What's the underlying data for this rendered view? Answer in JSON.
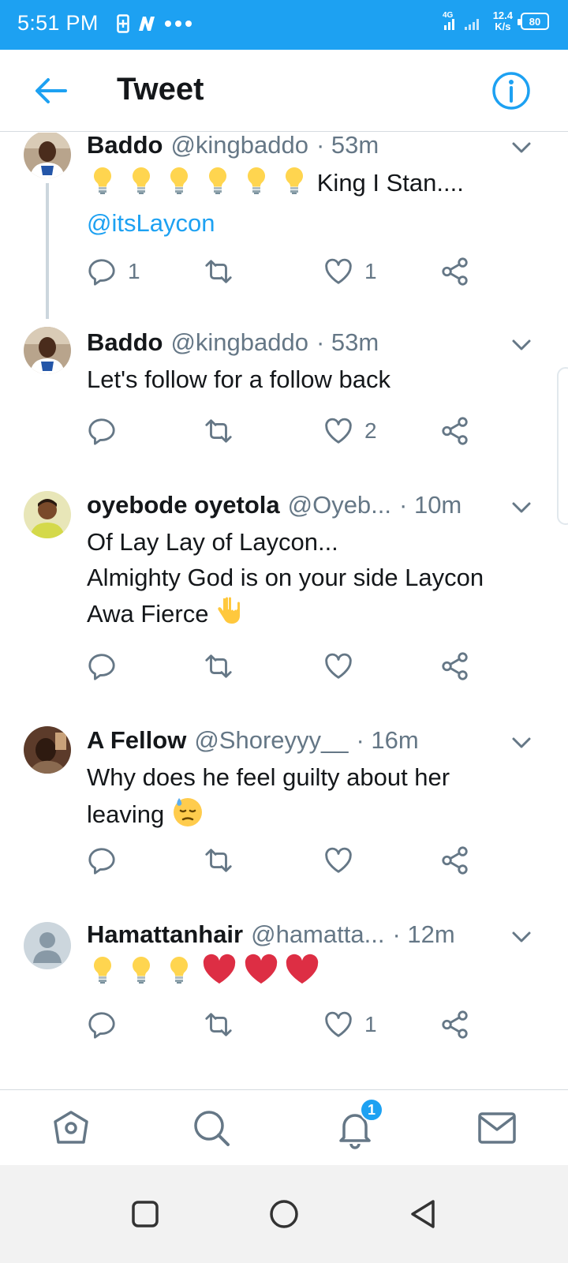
{
  "status_bar": {
    "time": "5:51 PM",
    "network_type": "4G",
    "speed_value": "12.4",
    "speed_unit": "K/s",
    "battery": "80",
    "icons": [
      "sim-icon",
      "app-n-icon",
      "more-dots-icon",
      "signal-icon",
      "battery-icon"
    ]
  },
  "header": {
    "title": "Tweet",
    "back_icon": "back-arrow-icon",
    "info_icon": "info-icon"
  },
  "colors": {
    "accent": "#1da1f2",
    "text": "#14171a",
    "muted": "#657786",
    "divider": "#d6dbe0"
  },
  "tweets": [
    {
      "name": "Baddo",
      "handle": "@kingbaddo",
      "time": "· 53m",
      "text": "King I Stan....",
      "mention": "@itsLaycon",
      "emoji": [
        "lightbulb",
        "lightbulb",
        "lightbulb",
        "lightbulb",
        "lightbulb",
        "lightbulb"
      ],
      "reply_count": "1",
      "retweet_count": "",
      "like_count": "1"
    },
    {
      "name": "Baddo",
      "handle": "@kingbaddo",
      "time": "· 53m",
      "text": "Let's follow for a follow back",
      "reply_count": "",
      "retweet_count": "",
      "like_count": "2"
    },
    {
      "name": "oyebode oyetola",
      "handle": "@Oyeb...",
      "time": "· 10m",
      "lines": [
        "Of Lay Lay of Laycon...",
        "Almighty God is on your side Laycon",
        "Awa Fierce"
      ],
      "emoji": [
        "rock-on-hand"
      ],
      "reply_count": "",
      "retweet_count": "",
      "like_count": ""
    },
    {
      "name": "A Fellow",
      "handle": "@Shoreyyy__",
      "time": "· 16m",
      "lines": [
        "Why does he feel guilty about her",
        "leaving"
      ],
      "emoji": [
        "downcast-face-with-sweat"
      ],
      "reply_count": "",
      "retweet_count": "",
      "like_count": ""
    },
    {
      "name": "Hamattanhair",
      "handle": "@hamatta...",
      "time": "· 12m",
      "emoji": [
        "lightbulb",
        "lightbulb",
        "lightbulb",
        "red-heart",
        "red-heart",
        "red-heart"
      ],
      "reply_count": "",
      "retweet_count": "",
      "like_count": "1"
    }
  ],
  "bottom_nav": {
    "items": [
      "home-icon",
      "search-icon",
      "notifications-icon",
      "messages-icon"
    ],
    "notification_badge": "1"
  },
  "system_nav": [
    "recents-square-icon",
    "home-circle-icon",
    "back-triangle-icon"
  ]
}
